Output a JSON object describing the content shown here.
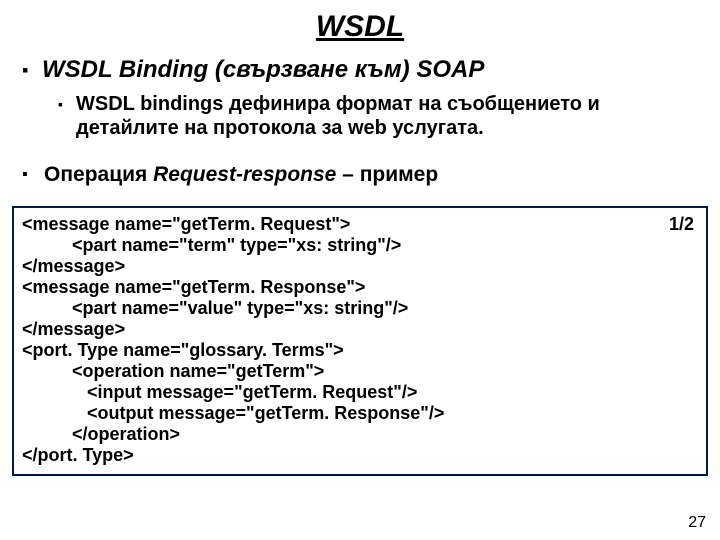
{
  "title": "WSDL",
  "bullet1": "WSDL Binding (свързване към) SOAP",
  "bullet1_sub": "WSDL bindings дефинира формат на съобщението и детайлите на протокола за web услугата.",
  "bullet2_pre": "Операция ",
  "bullet2_it": "Request-response",
  "bullet2_post": " – пример",
  "code": {
    "pager": "1/2",
    "l1": "<message name=\"getTerm. Request\">",
    "l2": "          <part name=\"term\" type=\"xs: string\"/>",
    "l3": "</message>",
    "l4": "<message name=\"getTerm. Response\">",
    "l5": "          <part name=\"value\" type=\"xs: string\"/>",
    "l6": "</message>",
    "l7": "<port. Type name=\"glossary. Terms\">",
    "l8": "          <operation name=\"getTerm\">",
    "l9": "             <input message=\"getTerm. Request\"/>",
    "l10": "             <output message=\"getTerm. Response\"/>",
    "l11": "          </operation>",
    "l12": "</port. Type>"
  },
  "slide_number": "27"
}
